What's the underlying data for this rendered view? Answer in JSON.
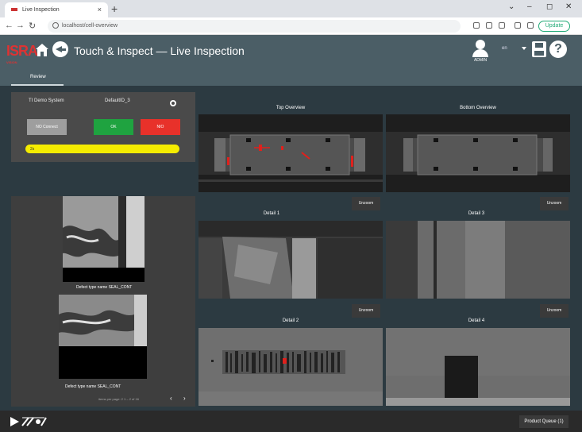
{
  "browser": {
    "tab_title": "Live Inspection",
    "tab_close": "×",
    "new_tab": "+",
    "url": "localhost/cell-overview",
    "update_label": "Update",
    "win_min": "–",
    "win_max": "◻",
    "win_close": "✕",
    "win_chevron": "⌄"
  },
  "header": {
    "logo": "ISRA",
    "logo_sub": "VISION",
    "title": "Touch & Inspect — Live Inspection",
    "user_label": "ADMIN",
    "language": "en",
    "help": "?"
  },
  "subnav": {
    "review_tab": "Review"
  },
  "status_panel": {
    "system": "TI Demo System",
    "default_id": "DefaultID_3",
    "btn_no_connect": "NO Connect",
    "btn_ok": "OK",
    "btn_nio": "NIO",
    "progress_label": "2s",
    "progress_fraction": 1.0
  },
  "defects": {
    "items": [
      {
        "label": "Defect type name  SEAL_CONT"
      },
      {
        "label": "Defect type name  SEAL_CONT"
      }
    ],
    "pager_text": "items per page: 2    1 – 2 of 16",
    "prev": "‹",
    "next": "›"
  },
  "views": {
    "top_overview": "Top Overview",
    "bottom_overview": "Bottom Overview",
    "detail1": "Detail 1",
    "detail2": "Detail 2",
    "detail3": "Detail 3",
    "detail4": "Detail 4",
    "unzoom": "Unzoom"
  },
  "footer": {
    "product_queue": "Product Queue (1)"
  },
  "colors": {
    "header_bg": "#4b5e66",
    "ok_green": "#1fa340",
    "nio_red": "#e8312a",
    "progress_yellow": "#f5ec00",
    "marker_red": "#e0201c"
  }
}
